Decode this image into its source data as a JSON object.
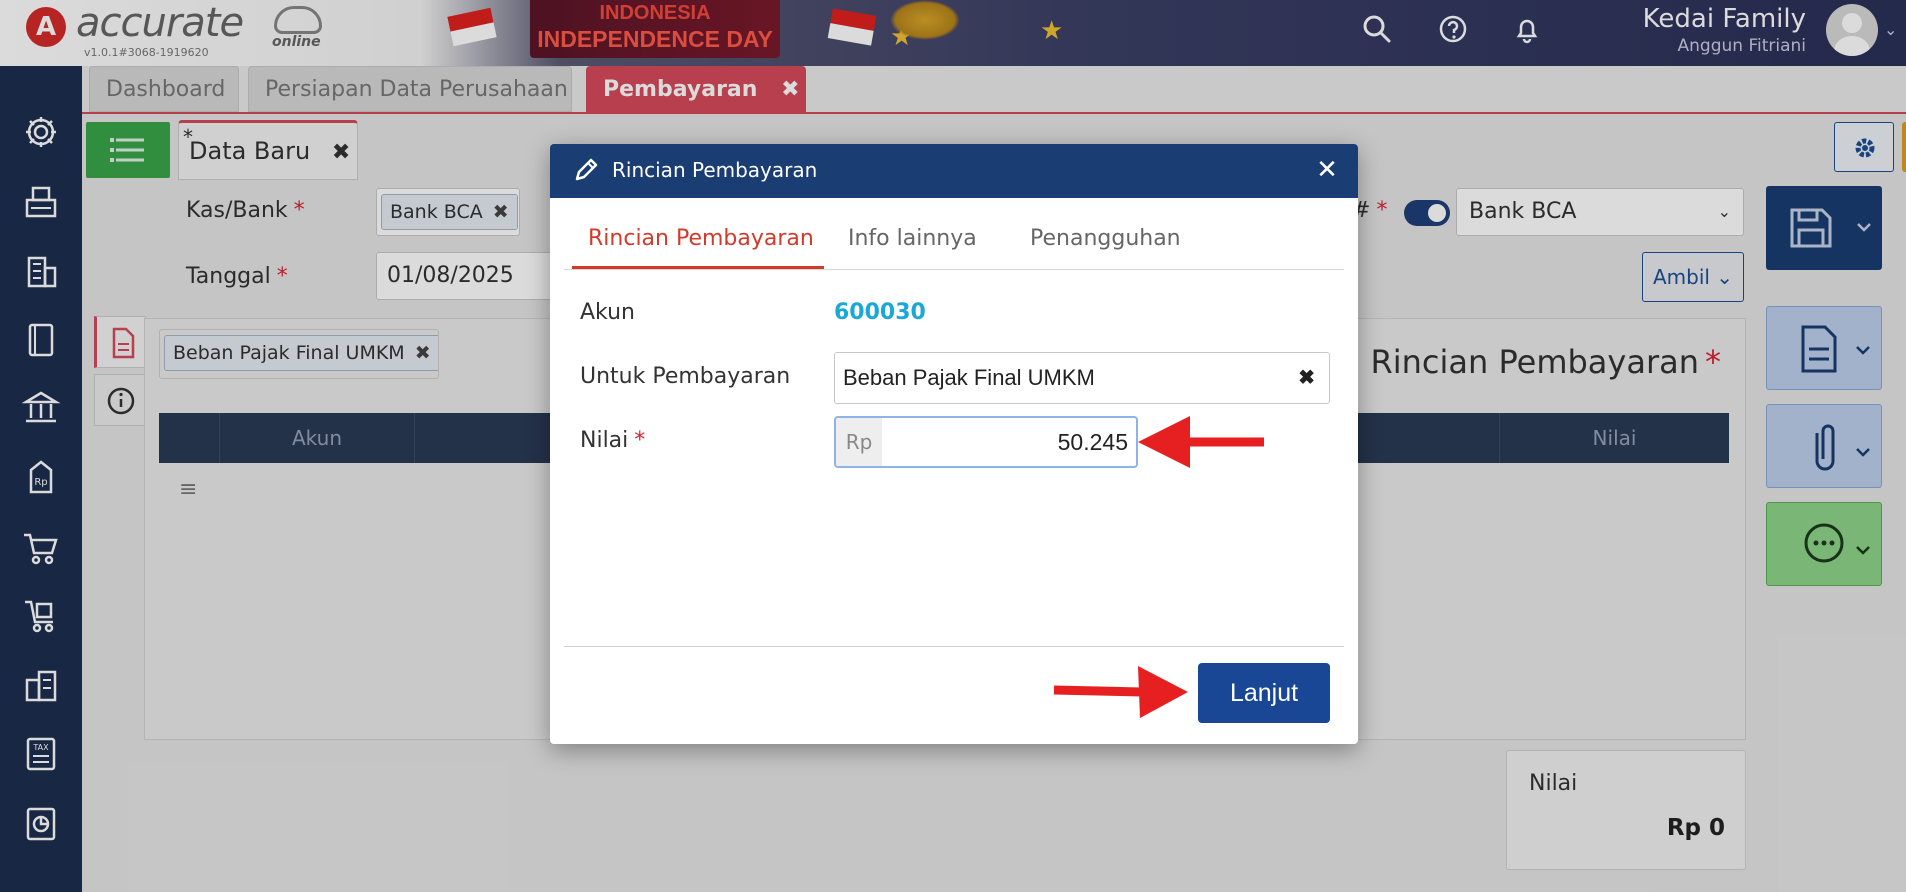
{
  "header": {
    "logo_mark": "A",
    "logo_text": "accurate",
    "logo_sub": "online",
    "version": "v1.0.1#3068-1919620",
    "banner_line1": "INDONESIA",
    "banner_line2": "INDEPENDENCE DAY",
    "company_name": "Kedai Family",
    "user_name": "Anggun Fitriani"
  },
  "tabs": [
    {
      "label": "Dashboard"
    },
    {
      "label": "Persiapan Data Perusahaan"
    },
    {
      "label": "Pembayaran",
      "close": "✖"
    }
  ],
  "tab_count": "3 ⌄",
  "doc_tab": {
    "label": "Data Baru",
    "modified_mark": "*",
    "close": "✖"
  },
  "form": {
    "kasbank_label": "Kas/Bank",
    "kasbank_value": "Bank BCA",
    "tanggal_label": "Tanggal",
    "tanggal_value": "01/08/2025",
    "required_mark": "*",
    "right_select_value": "Bank BCA",
    "right_label_suffix": "#",
    "ambil_label": "Ambil ⌄",
    "chip_x": "✖"
  },
  "detail": {
    "account_chip": "Beban Pajak Final UMKM",
    "title": "Rincian Pembayaran",
    "table_headers": [
      "Akun",
      "Nilai"
    ],
    "menu_glyph": "≡"
  },
  "total": {
    "label": "Nilai",
    "value": "Rp 0"
  },
  "modal": {
    "title": "Rincian Pembayaran",
    "close": "✕",
    "tabs": [
      "Rincian Pembayaran",
      "Info lainnya",
      "Penangguhan"
    ],
    "akun_label": "Akun",
    "akun_value": "600030",
    "untuk_label": "Untuk Pembayaran",
    "untuk_value": "Beban Pajak Final UMKM",
    "untuk_clear": "✖",
    "nilai_label": "Nilai",
    "nilai_prefix": "Rp",
    "nilai_value": "50.245",
    "submit_label": "Lanjut"
  },
  "colors": {
    "sidebar": "#1c2e4e",
    "active_tab": "#d74a5a",
    "modal_header": "#1a3d73",
    "primary_button": "#1a4696",
    "link": "#1ba8d8",
    "annotation_arrow": "#e62020"
  },
  "icons": [
    "search-icon",
    "help-icon",
    "bell-icon",
    "gear-icon",
    "bulb-icon",
    "save-icon",
    "document-icon",
    "paperclip-icon",
    "more-icon",
    "pencil-icon",
    "list-icon",
    "info-icon"
  ]
}
